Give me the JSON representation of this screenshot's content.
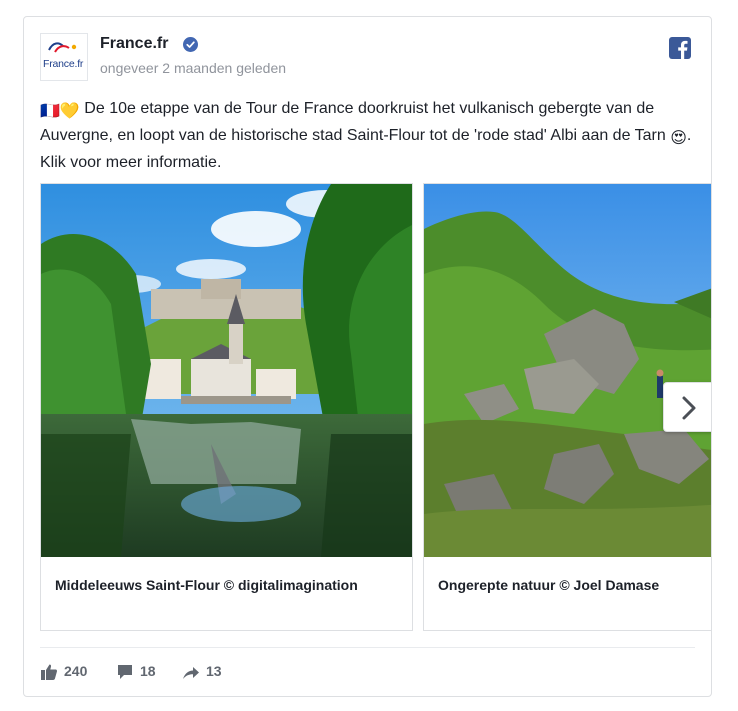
{
  "post": {
    "page_name": "France.fr",
    "avatar_text": "France.fr",
    "timestamp": "ongeveer 2 maanden geleden",
    "message_flags": "🇫🇷💛",
    "message_part1": "De 10e etappe van de Tour de France doorkruist het vulkanisch gebergte van de Auvergne, en loopt van de historische stad Saint-Flour tot de 'rode stad' Albi aan de Tarn",
    "message_emoji": "😍",
    "message_part2": ". Klik voor meer informatie."
  },
  "carousel": {
    "slides": [
      {
        "caption": "Middeleeuws Saint-Flour © digitalimagination"
      },
      {
        "caption": "Ongerepte natuur © Joel Damase"
      }
    ]
  },
  "stats": {
    "likes": "240",
    "comments": "18",
    "shares": "13"
  },
  "colors": {
    "facebook_blue": "#3b5998",
    "verified_blue": "#4267b2",
    "text": "#1d2129",
    "muted": "#90949c"
  },
  "icons": [
    "verified-icon",
    "facebook-icon",
    "chevron-right-icon",
    "like-icon",
    "comment-icon",
    "share-icon"
  ]
}
